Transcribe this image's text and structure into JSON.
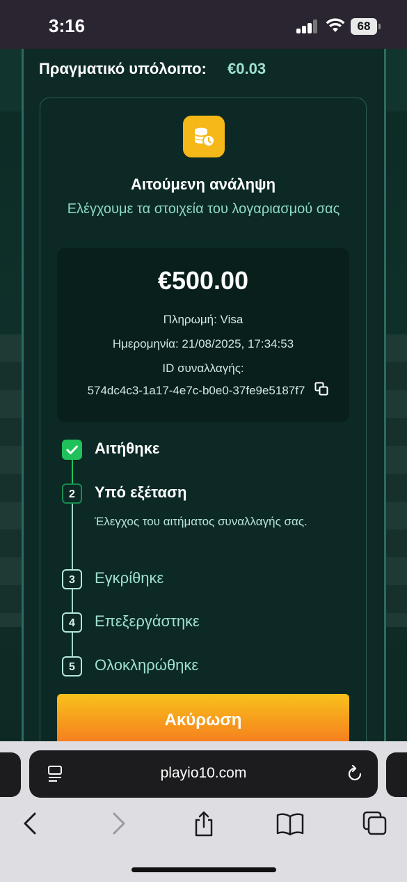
{
  "status_bar": {
    "time": "3:16",
    "battery": "68"
  },
  "header": {
    "balance_label": "Πραγματικό υπόλοιπο:",
    "balance_value": "€0.03"
  },
  "withdrawal": {
    "icon": "coins-clock-icon",
    "title": "Αιτούμενη ανάληψη",
    "subtitle": "Ελέγχουμε τα στοιχεία του λογαριασμού σας",
    "amount": "€500.00",
    "payment": "Πληρωμή: Visa",
    "date": "Ημερομηνία: 21/08/2025, 17:34:53",
    "txn_label": "ID συναλλαγής:",
    "txn_id": "574dc4c3-1a17-4e7c-b0e0-37fe9e5187f7"
  },
  "steps": [
    {
      "num": "",
      "label": "Αιτήθηκε",
      "state": "done"
    },
    {
      "num": "2",
      "label": "Υπό εξέταση",
      "state": "active",
      "description": "Έλεγχος του αιτήματος συναλλαγής σας."
    },
    {
      "num": "3",
      "label": "Εγκρίθηκε",
      "state": "pending"
    },
    {
      "num": "4",
      "label": "Επεξεργάστηκε",
      "state": "pending"
    },
    {
      "num": "5",
      "label": "Ολοκληρώθηκε",
      "state": "pending"
    }
  ],
  "cancel_button": "Ακύρωση",
  "browser": {
    "url": "playio10.com"
  },
  "colors": {
    "accent": "#9fe0d4",
    "success": "#1fc25a",
    "badge": "#f5b818",
    "button_top": "#f8c21c",
    "button_bottom": "#f57a1e"
  }
}
